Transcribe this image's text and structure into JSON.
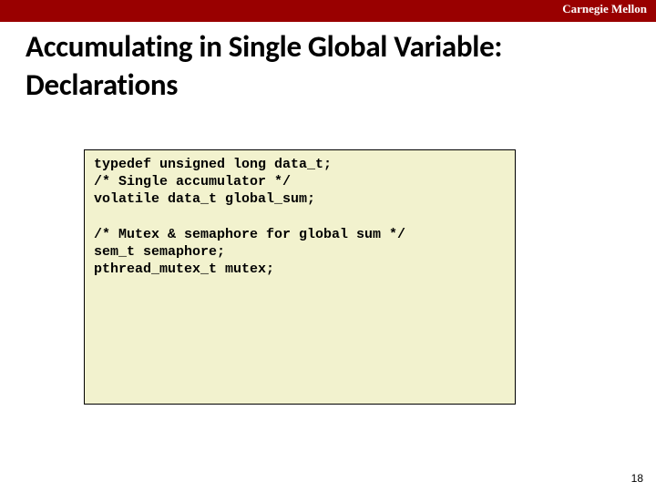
{
  "header": {
    "brand": "Carnegie Mellon"
  },
  "title": "Accumulating in Single Global Variable:\n Declarations",
  "code": "typedef unsigned long data_t;\n/* Single accumulator */\nvolatile data_t global_sum;\n\n/* Mutex & semaphore for global sum */\nsem_t semaphore;\npthread_mutex_t mutex;",
  "page_number": "18"
}
